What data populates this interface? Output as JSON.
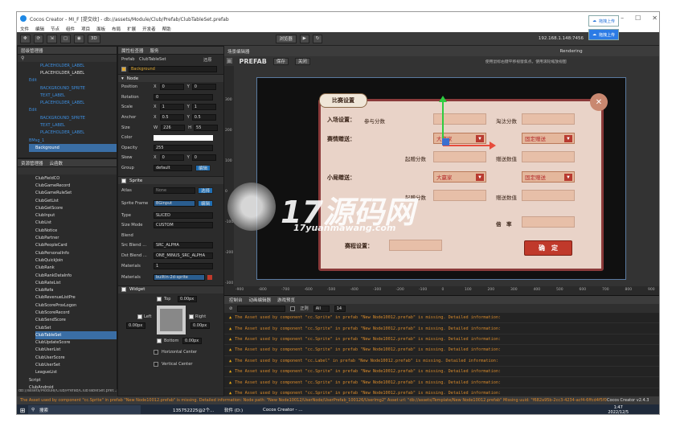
{
  "window": {
    "title": "Cocos Creator - MI_F [提交纹] - db://assets/Module/Club/Prefab/ClubTableSet.prefab"
  },
  "menu": [
    "文件",
    "编辑",
    "节点",
    "组件",
    "项目",
    "面板",
    "布局",
    "扩展",
    "开发者",
    "帮助"
  ],
  "toolbar": {
    "mode_label": "浏览器",
    "ip": "192.168.1.148:7456",
    "version": "v2.4.3",
    "layer_btn": "3D"
  },
  "upload": {
    "a": "拖拽上传",
    "b": "拖拽上传"
  },
  "hierarchy": {
    "title": "层级管理器",
    "items": [
      "PLACEHOLDER_LABEL",
      "Edit",
      "BACKGROUND_SPRITE",
      "TEXT_LABEL",
      "PLACEHOLDER_LABEL",
      "Edit",
      "BACKGROUND_SPRITE",
      "TEXT_LABEL",
      "PLACEHOLDER_LABEL",
      "BMsg_1",
      "Background"
    ]
  },
  "assets": {
    "title": "资源管理器",
    "tab2": "云函数",
    "items": [
      "ClubFieldCO",
      "ClubGameRecord",
      "ClubGameRuleSet",
      "ClubGetList",
      "ClubGetScore",
      "ClubInput",
      "ClubList",
      "ClubNotice",
      "ClubPartner",
      "ClubPeopleCard",
      "ClubPersonalInfo",
      "ClubQuickJoin",
      "ClubRank",
      "ClubRankDataInfo",
      "ClubRateList",
      "ClubRefa",
      "ClubRevenueListPre",
      "ClubScoreProxLogon",
      "ClubScoreRecord",
      "ClubSendScore",
      "ClubSet",
      "ClubTableSet",
      "ClubUpdateScore",
      "ClubUserList",
      "ClubUserScore",
      "ClubUserSet",
      "LeagueList",
      "Script",
      "ClubAndroid",
      "Com 4"
    ],
    "path": "db://assets/Module/Club/Prefab/ClubTableSet.pref..."
  },
  "inspector": {
    "title": "属性检查器",
    "tab2": "服务",
    "prefab_label": "Prefab",
    "prefab_name": "ClubTableSet",
    "prefab_btn": "还原",
    "node_name": "Background",
    "node_section": "Node",
    "position": {
      "label": "Position",
      "x": "0",
      "y": "0"
    },
    "rotation": {
      "label": "Rotation",
      "v": "0"
    },
    "scale": {
      "label": "Scale",
      "x": "1",
      "y": "1"
    },
    "anchor": {
      "label": "Anchor",
      "x": "0.5",
      "y": "0.5"
    },
    "size": {
      "label": "Size",
      "w": "226",
      "h": "55"
    },
    "color": {
      "label": "Color"
    },
    "opacity": {
      "label": "Opacity",
      "v": "255"
    },
    "skew": {
      "label": "Skew",
      "x": "0",
      "y": "0"
    },
    "group": {
      "label": "Group",
      "v": "default",
      "btn": "编辑"
    },
    "sprite_section": "Sprite",
    "atlas": {
      "label": "Atlas",
      "v": "None",
      "btn": "选择"
    },
    "sprite_frame": {
      "label": "Sprite Frame",
      "v": "BGinput",
      "btn": "编辑"
    },
    "type": {
      "label": "Type",
      "v": "SLICED"
    },
    "size_mode": {
      "label": "Size Mode",
      "v": "CUSTOM"
    },
    "blend": {
      "label": "Blend"
    },
    "src_blend": {
      "label": "Src Blend ...",
      "v": "SRC_ALPHA"
    },
    "dst_blend": {
      "label": "Dst Blend ...",
      "v": "ONE_MINUS_SRC_ALPHA"
    },
    "materials_section": "Materials",
    "materials_count": "1",
    "materials_item": {
      "label": "Materials",
      "v": "builtin-2d-sprite"
    },
    "widget_section": "Widget",
    "top": {
      "label": "Top",
      "v": "0.00px"
    },
    "left": {
      "label": "Left",
      "v": "0.00px"
    },
    "right": {
      "label": "Right",
      "v": "0.00px"
    },
    "bottom": {
      "label": "Bottom",
      "v": "0.00px"
    },
    "hcenter": "Horizontal Center",
    "vcenter": "Vertical Center"
  },
  "scene": {
    "title": "场景编辑器",
    "prefab_tag": "PREFAB",
    "save_btn": "保存",
    "close_btn": "关闭",
    "hint": "使用鼠标右键平移视窗焦点。使用滚轮缩放视图",
    "rendering": "Rendering",
    "x_ticks": [
      "-900",
      "-800",
      "-700",
      "-600",
      "-500",
      "-400",
      "-300",
      "-200",
      "-100",
      "0",
      "100",
      "200",
      "300",
      "400",
      "500",
      "600",
      "700",
      "800",
      "900"
    ],
    "y_ticks": [
      "300",
      "200",
      "100",
      "0",
      "-100",
      "-200",
      "-300"
    ]
  },
  "dialog": {
    "title": "比赛设置",
    "row1_label": "入场设置：",
    "row1_a": "参与分数",
    "row1_b": "淘汰分数",
    "row2_label": "赛情赠送：",
    "row2_drop1": "大赢家",
    "row2_drop2": "固定赠送",
    "row3_a": "起赠分数",
    "row3_b": "赠送数值",
    "row4_label": "小局赠送：",
    "row4_drop1": "大赢家",
    "row4_drop2": "固定赠送",
    "row5_a": "起赠分数",
    "row5_b": "赠送数值",
    "row6_label": "倍　率",
    "row7_label": "赛程设置：",
    "ok_btn": "确　定"
  },
  "watermark": {
    "big": "17源码网",
    "small": "17yuanmawang.com"
  },
  "console": {
    "title": "控制台",
    "tab2": "动画编辑器",
    "tab3": "游戏预览",
    "level": "正则",
    "filter": "All",
    "fontsize": "14",
    "rows": [
      "The Asset used by component \"cc.Sprite\" in prefab \"New Node10012.prefab\" is missing. Detailed information:",
      "The Asset used by component \"cc.Sprite\" in prefab \"New Node10012.prefab\" is missing. Detailed information:",
      "The Asset used by component \"cc.Sprite\" in prefab \"New Node10012.prefab\" is missing. Detailed information:",
      "The Asset used by component \"cc.Sprite\" in prefab \"New Node10012.prefab\" is missing. Detailed information:",
      "The Asset used by component \"cc.Label\" in prefab \"New Node10012.prefab\" is missing. Detailed information:",
      "The Asset used by component \"cc.Sprite\" in prefab \"New Node10012.prefab\" is missing. Detailed information:",
      "The Asset used by component \"cc.Sprite\" in prefab \"New Node10012.prefab\" is missing. Detailed information:",
      "The Asset used by component \"cc.Sprite\" in prefab \"New Node10012.prefab\" is missing. Detailed information:"
    ]
  },
  "status": {
    "message": "The Asset used by component \"cc.Sprite\" in prefab \"New Node10012.prefab\" is missing. Detailed information: Node path: \"New Node10012/UserNode/UserPrefab_100126/UserImg2\" Asset url: \"db://assets/Template/New Node10012.prefab\" Missing uuid: \"f682a95b-2cc3-4234-acf4-6ffcd4f5f080\"",
    "version": "Cocos Creator v2.4.3"
  },
  "taskbar": {
    "search": "搜索",
    "app1": "135752225@2个...",
    "app2": "软件 (D:)",
    "app3": "Cocos Creator - ...",
    "time": "1:47",
    "date": "2022/12/5"
  }
}
